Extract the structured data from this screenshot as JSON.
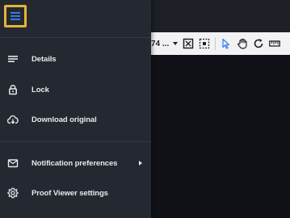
{
  "toolbar": {
    "zoom_value": "74 ...",
    "icons": [
      "fit-screen-icon",
      "select-region-icon",
      "pointer-icon",
      "pan-hand-icon",
      "rotate-icon",
      "ruler-icon"
    ]
  },
  "menu": {
    "toggle_icon": "hamburger-icon",
    "items": [
      {
        "label": "Details",
        "icon": "details-lines-icon"
      },
      {
        "label": "Lock",
        "icon": "lock-icon"
      },
      {
        "label": "Download original",
        "icon": "cloud-download-icon"
      },
      {
        "label": "Notification preferences",
        "icon": "mail-icon",
        "has_submenu": true
      },
      {
        "label": "Proof Viewer settings",
        "icon": "gear-icon"
      }
    ]
  },
  "colors": {
    "menu_bg": "#242830",
    "highlight_border": "#e2b53a",
    "accent_blue": "#3b82f6",
    "text": "#e6e8ec"
  }
}
